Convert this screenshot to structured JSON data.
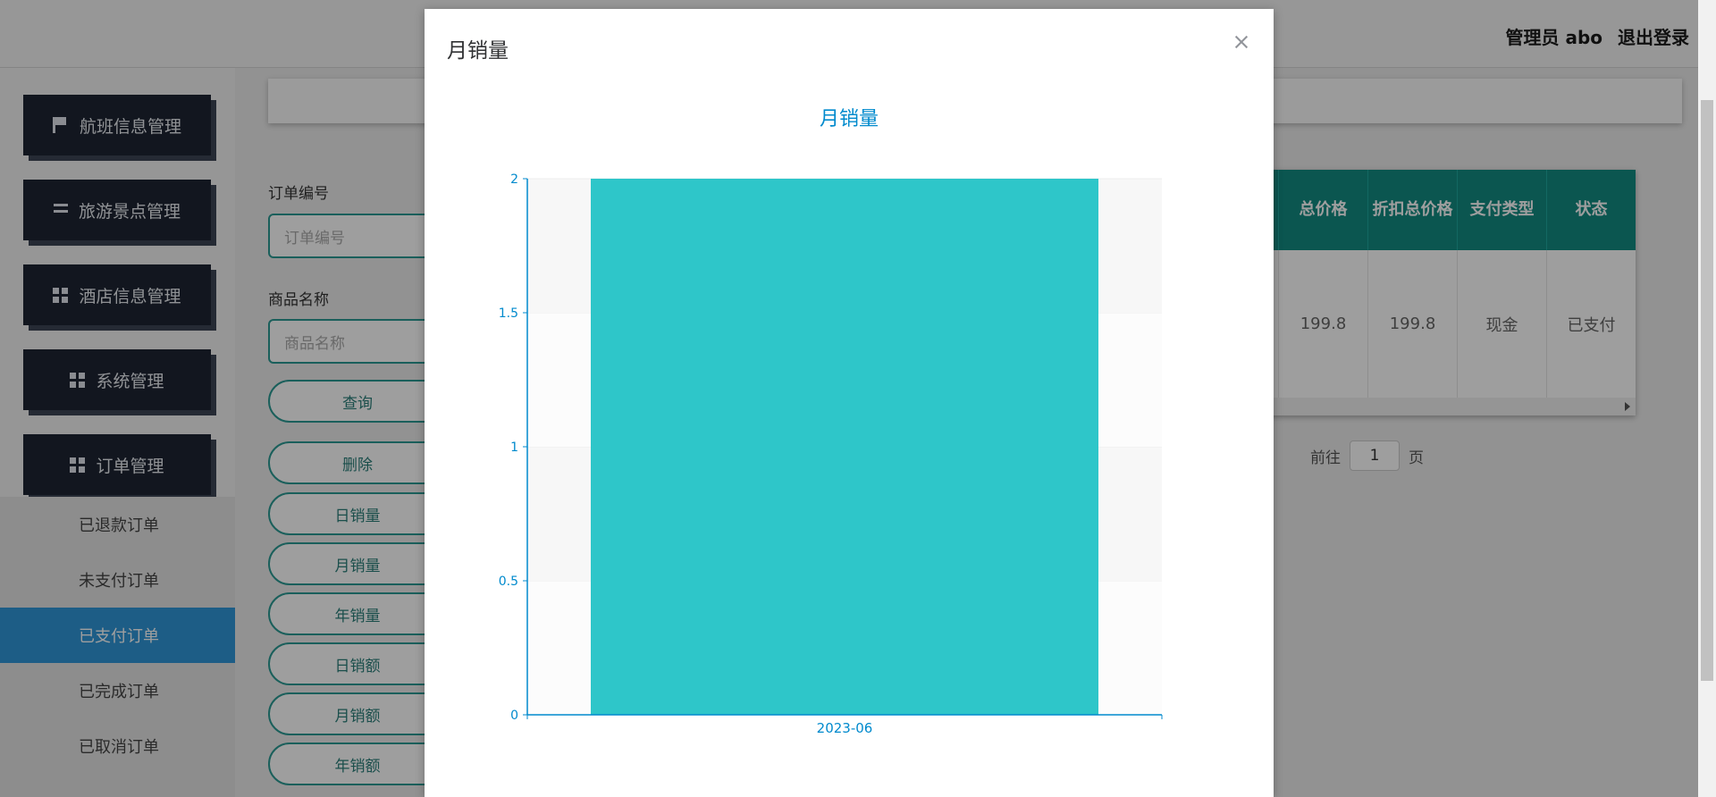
{
  "header": {
    "user_label": "管理员 abo",
    "logout_label": "退出登录"
  },
  "sidebar": {
    "items": [
      {
        "label": "航班信息管理",
        "icon": "flag-icon"
      },
      {
        "label": "旅游景点管理",
        "icon": "list-icon"
      },
      {
        "label": "酒店信息管理",
        "icon": "grid-icon"
      },
      {
        "label": "系统管理",
        "icon": "table-icon"
      },
      {
        "label": "订单管理",
        "icon": "grid-icon"
      }
    ],
    "submenu": [
      {
        "label": "已退款订单"
      },
      {
        "label": "未支付订单"
      },
      {
        "label": "已支付订单",
        "active": true
      },
      {
        "label": "已完成订单"
      },
      {
        "label": "已取消订单"
      }
    ]
  },
  "filters": {
    "order_no_label": "订单编号",
    "order_no_placeholder": "订单编号",
    "goods_name_label": "商品名称",
    "goods_name_placeholder": "商品名称"
  },
  "buttons": {
    "query": "查询",
    "delete": "删除",
    "daily_sales": "日销量",
    "monthly_sales": "月销量",
    "yearly_sales": "年销量",
    "daily_amount": "日销额",
    "monthly_amount": "月销额",
    "yearly_amount": "年销额"
  },
  "table": {
    "columns": [
      "总价格",
      "折扣总价格",
      "支付类型",
      "状态"
    ],
    "rows": [
      [
        "199.8",
        "199.8",
        "现金",
        "已支付"
      ]
    ]
  },
  "pager": {
    "goto_label": "前往",
    "page_value": "1",
    "page_suffix": "页"
  },
  "modal": {
    "title": "月销量"
  },
  "chart_data": {
    "type": "bar",
    "title": "月销量",
    "categories": [
      "2023-06"
    ],
    "values": [
      2
    ],
    "ylim": [
      0,
      2
    ],
    "yticks": [
      "0",
      "0.5",
      "1",
      "1.5",
      "2"
    ],
    "grid": true,
    "colors": {
      "bar": "#2ec6c9",
      "axis": "#008acd"
    }
  }
}
